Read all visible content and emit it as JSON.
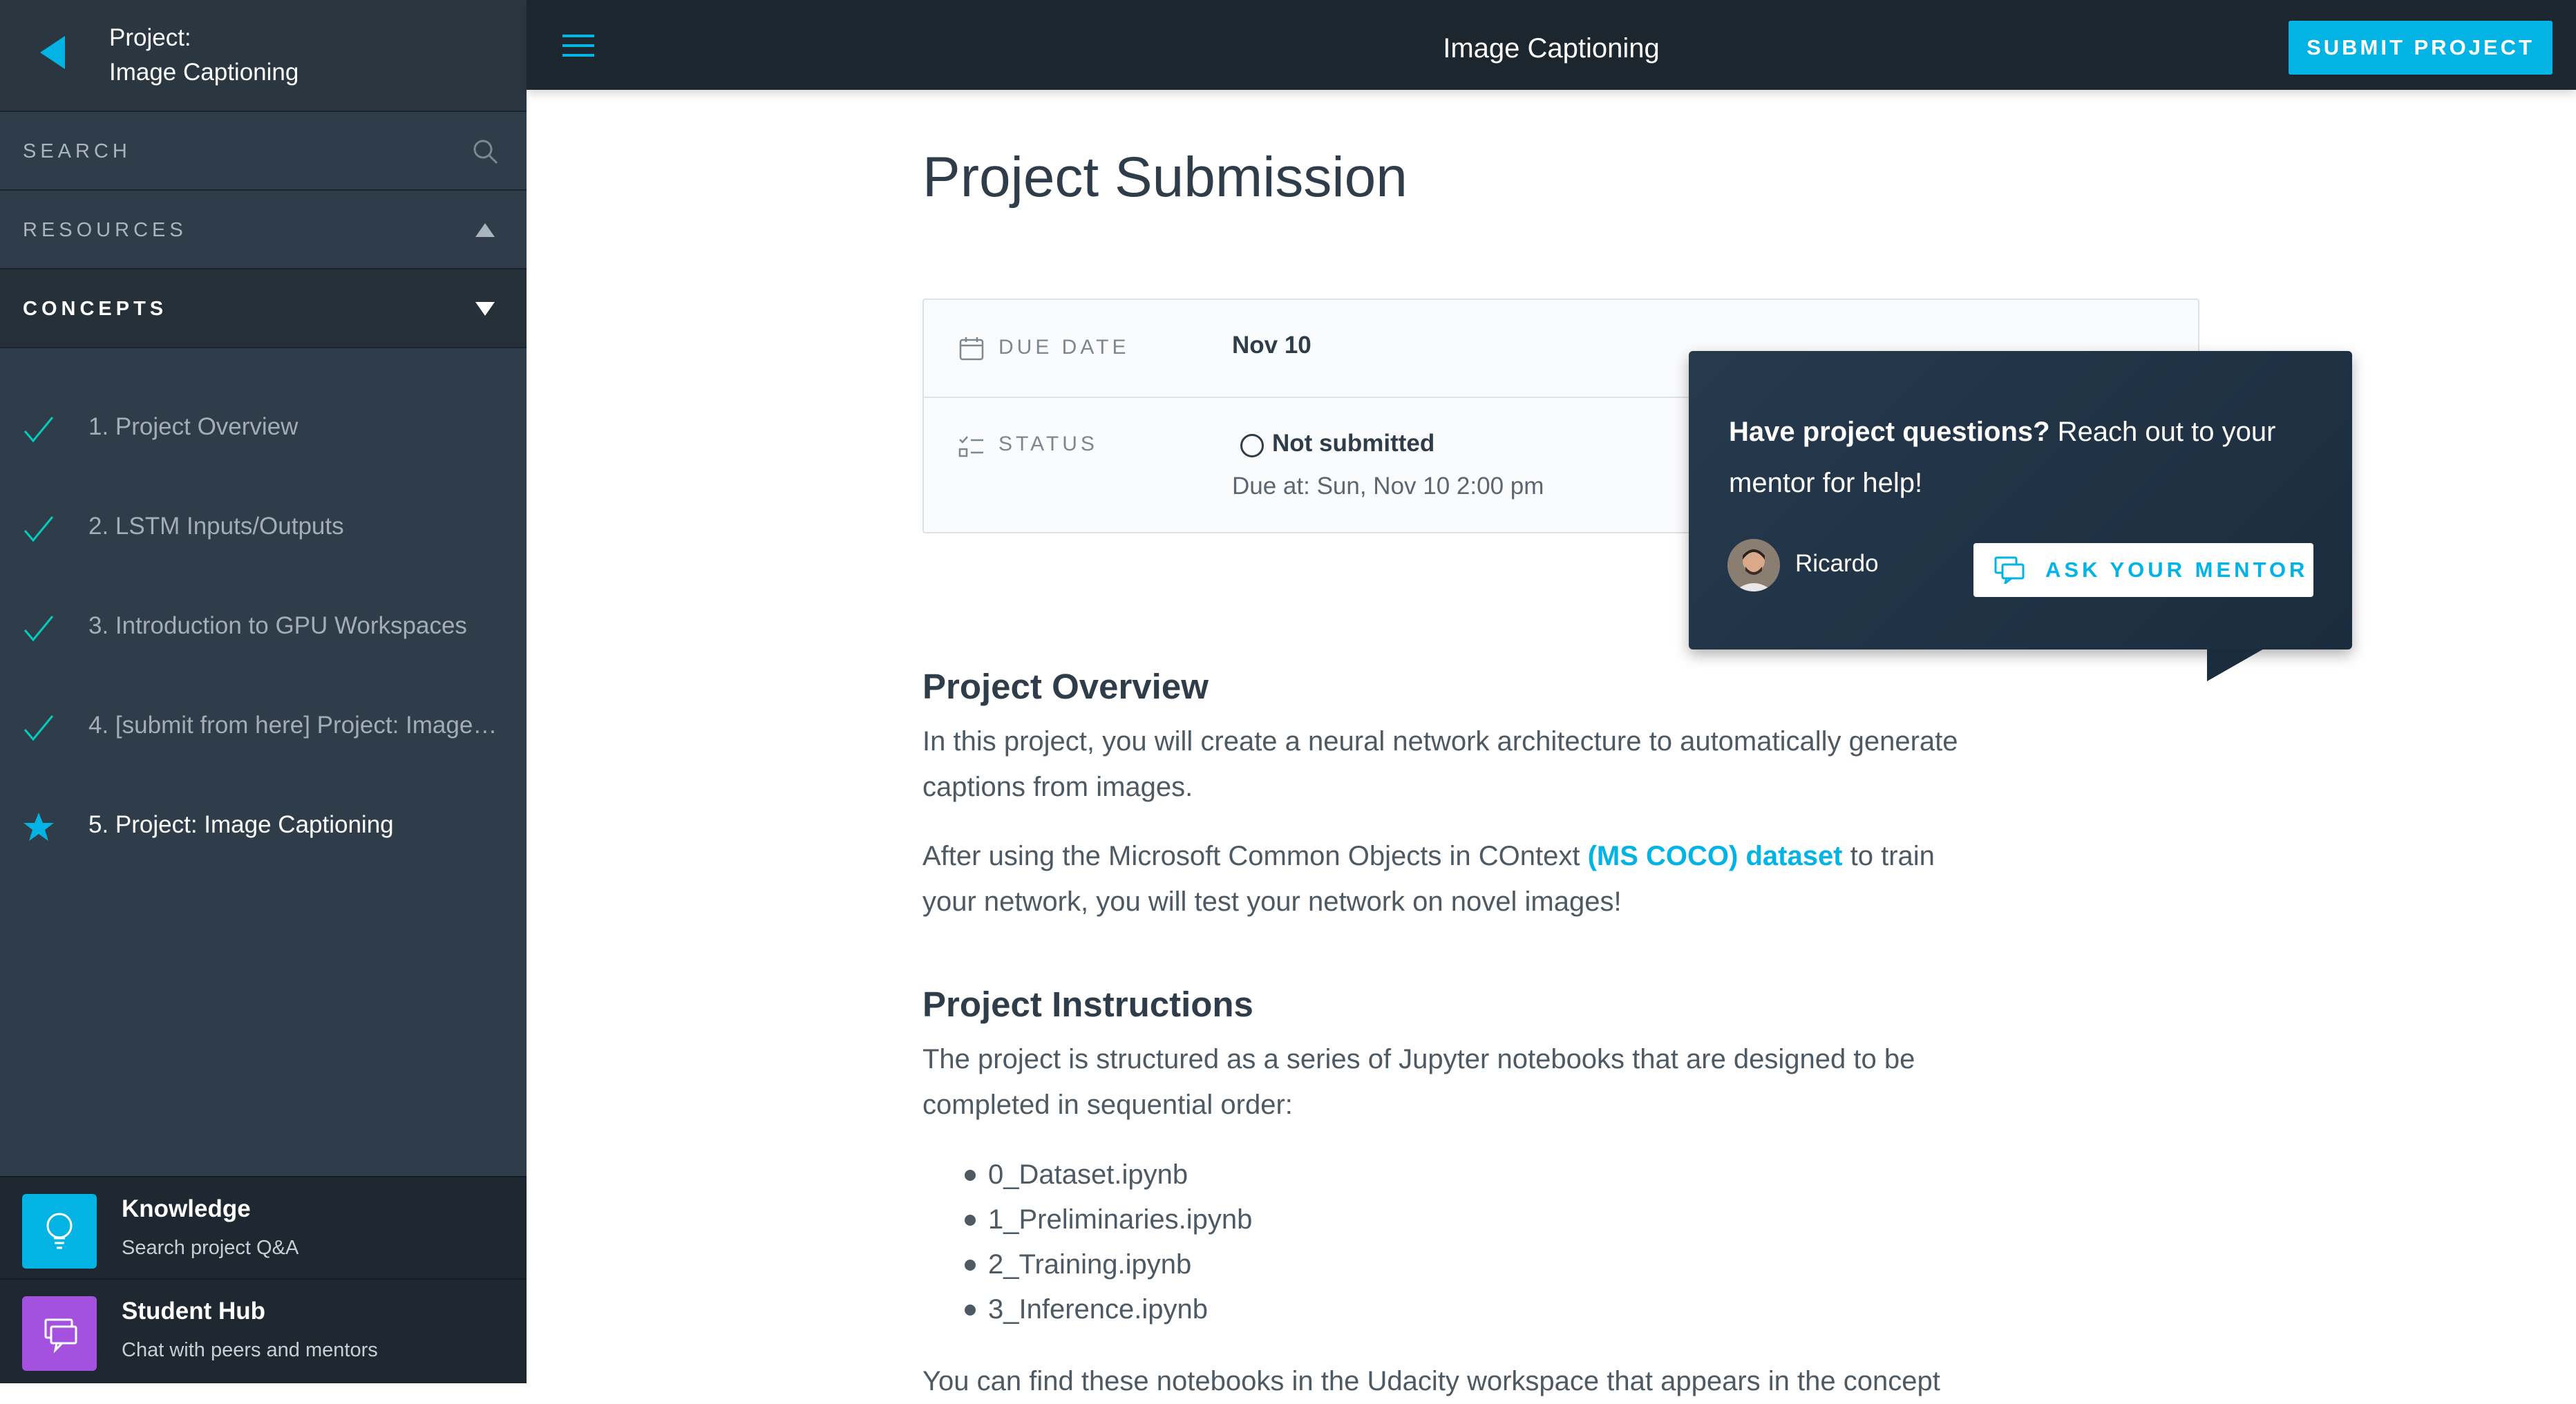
{
  "sidebar": {
    "project_label": "Project:",
    "project_name": "Image Captioning",
    "search_label": "SEARCH",
    "resources_label": "RESOURCES",
    "concepts_label": "CONCEPTS",
    "concepts": [
      {
        "label": "1. Project Overview",
        "state": "done"
      },
      {
        "label": "2. LSTM Inputs/Outputs",
        "state": "done"
      },
      {
        "label": "3. Introduction to GPU Workspaces",
        "state": "done"
      },
      {
        "label": "4. [submit from here] Project: Image…",
        "state": "done"
      },
      {
        "label": "5. Project: Image Captioning",
        "state": "current"
      }
    ],
    "knowledge": {
      "title": "Knowledge",
      "subtitle": "Search project Q&A",
      "icon": "lightbulb-icon",
      "color": "#02b3e4"
    },
    "hub": {
      "title": "Student Hub",
      "subtitle": "Chat with peers and mentors",
      "icon": "chat-bubbles-icon",
      "color": "#a451e0"
    }
  },
  "topbar": {
    "title": "Image Captioning",
    "submit_label": "SUBMIT PROJECT"
  },
  "main": {
    "page_title": "Project Submission",
    "due_label": "DUE DATE",
    "due_value": "Nov 10",
    "status_label": "STATUS",
    "status_value": "Not submitted",
    "status_due": "Due at: Sun, Nov 10 2:00 pm",
    "overview_heading": "Project Overview",
    "overview_text": "In this project, you will create a neural network architecture to automatically generate captions from images.",
    "after_text_1": "After using the Microsoft Common Objects in COntext ",
    "after_link": "(MS COCO) dataset",
    "after_text_2": " to train your network, you will test your network on novel images!",
    "instructions_heading": "Project Instructions",
    "instructions_text": "The project is structured as a series of Jupyter notebooks that are designed to be completed in sequential order:",
    "files": [
      "0_Dataset.ipynb",
      "1_Preliminaries.ipynb",
      "2_Training.ipynb",
      "3_Inference.ipynb"
    ],
    "find_text": "You can find these notebooks in the Udacity workspace that appears in the concept"
  },
  "mentor": {
    "question_bold": "Have project questions?",
    "question_rest": " Reach out to your mentor for help!",
    "name": "Ricardo",
    "ask_label": "ASK YOUR MENTOR"
  },
  "colors": {
    "accent": "#02b3e4",
    "sidebar_bg": "#2e3d49",
    "topbar_bg": "#1c262f",
    "hub_purple": "#a451e0"
  }
}
